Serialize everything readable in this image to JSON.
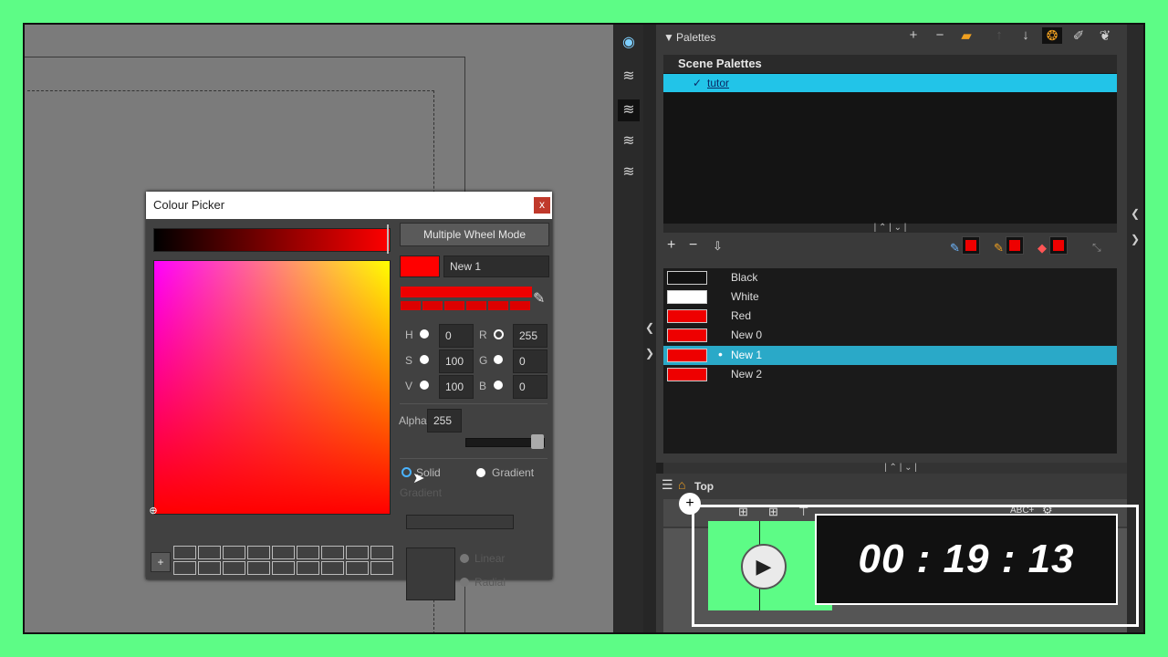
{
  "colour_picker": {
    "title": "Colour Picker",
    "close_label": "x",
    "wheel_mode_label": "Multiple Wheel Mode",
    "colour_name": "New 1",
    "h_label": "H",
    "h_value": "0",
    "s_label": "S",
    "s_value": "100",
    "v_label": "V",
    "v_value": "100",
    "r_label": "R",
    "r_value": "255",
    "g_label": "G",
    "g_value": "0",
    "b_label": "B",
    "b_value": "0",
    "alpha_label": "Alpha",
    "alpha_value": "255",
    "solid_label": "Solid",
    "gradient_label": "Gradient",
    "gradient_section_label": "Gradient",
    "linear_label": "Linear",
    "radial_label": "Radial",
    "add_swatch_label": "+",
    "current_colour": "#ff0000"
  },
  "palettes": {
    "title": "Palettes",
    "scene_palettes_label": "Scene Palettes",
    "scene_palette": {
      "check": "✓",
      "name": "tutor"
    },
    "colours": [
      {
        "name": "Black",
        "color": "#111111"
      },
      {
        "name": "White",
        "color": "#ffffff"
      },
      {
        "name": "Red",
        "color": "#ee0000"
      },
      {
        "name": "New 0",
        "color": "#ee0000"
      },
      {
        "name": "New 1",
        "color": "#ee0000",
        "selected": true
      },
      {
        "name": "New 2",
        "color": "#ee0000"
      }
    ]
  },
  "node_view": {
    "breadcrumb": "Top",
    "abc_label": "ABC+"
  },
  "timer": {
    "display": "00 : 19 : 13"
  }
}
